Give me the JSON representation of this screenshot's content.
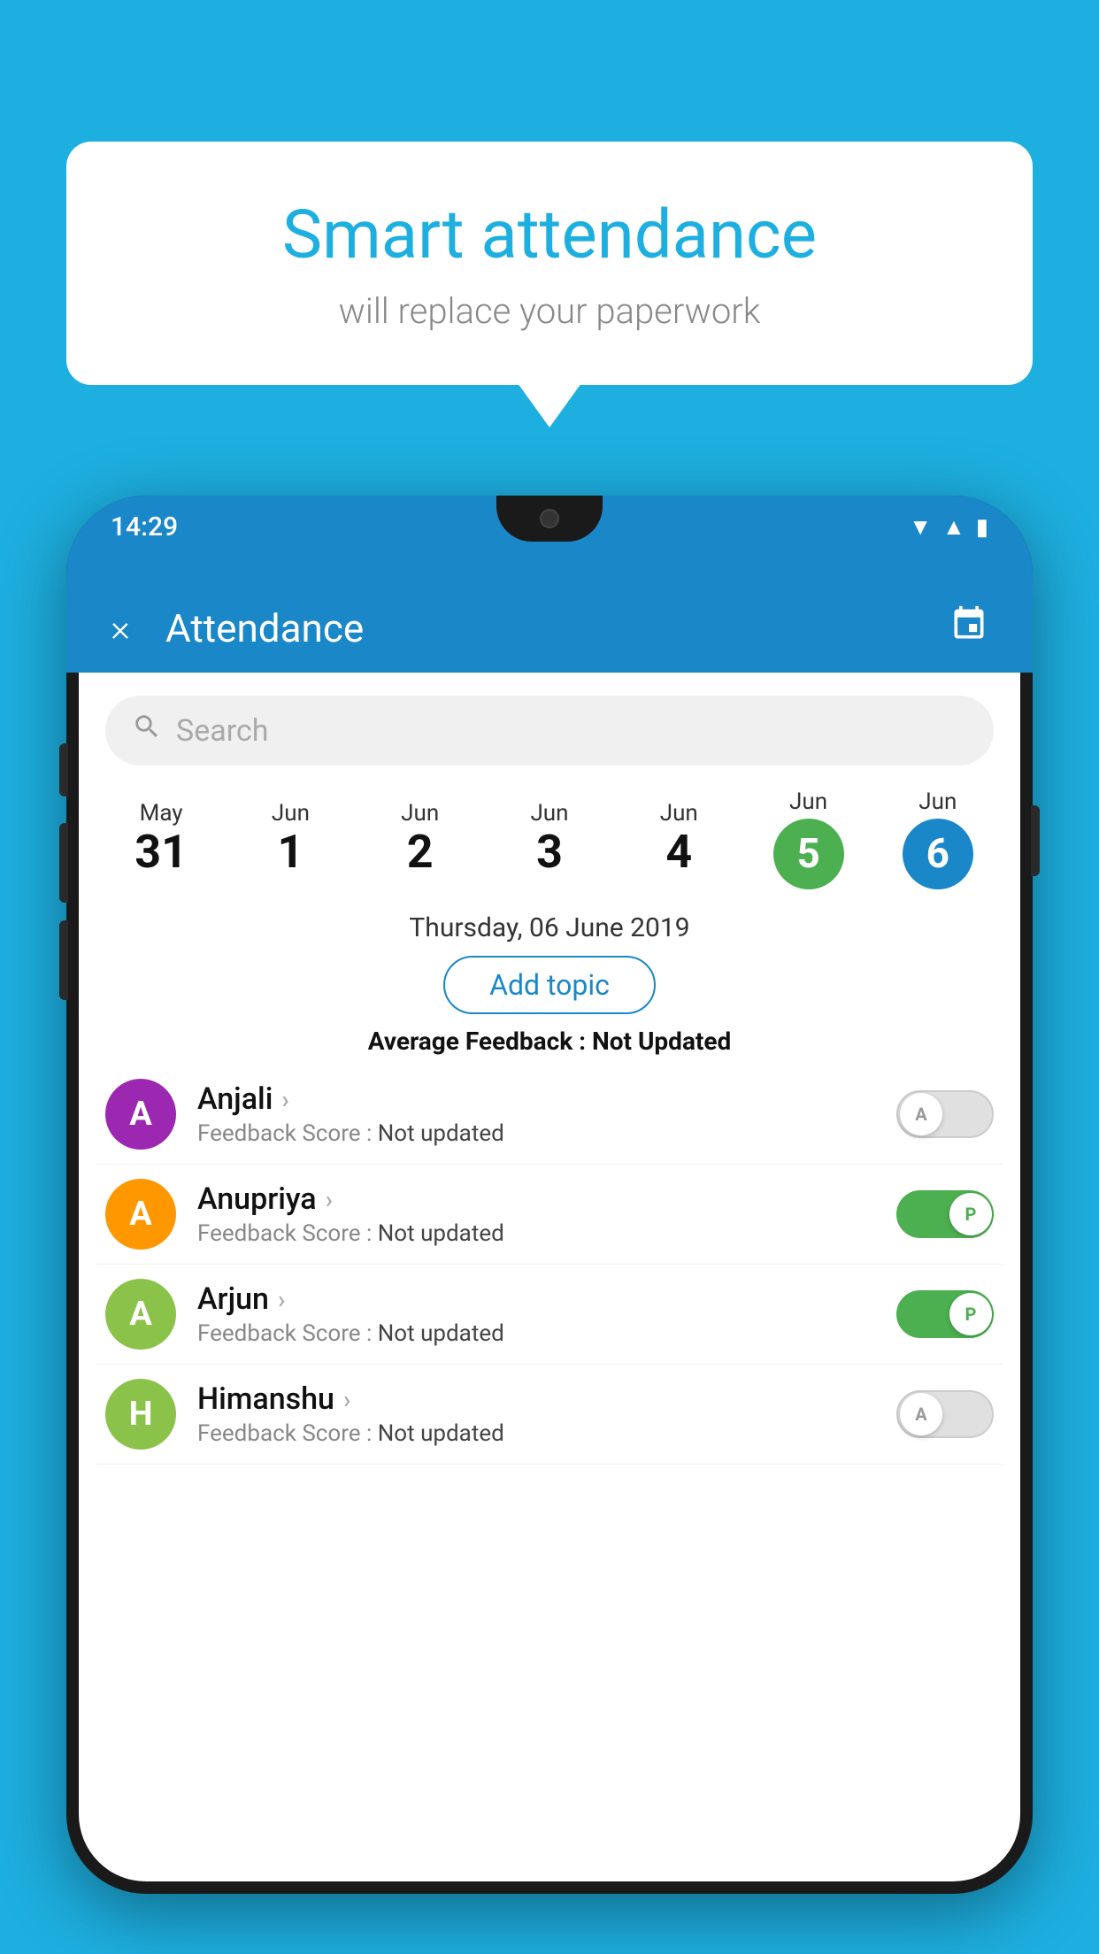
{
  "background_color": "#1DAFE0",
  "speech_bubble": {
    "title": "Smart attendance",
    "subtitle": "will replace your paperwork"
  },
  "status_bar": {
    "time": "14:29",
    "icons": [
      "wifi",
      "signal",
      "battery"
    ]
  },
  "app_header": {
    "title": "Attendance",
    "close_label": "×",
    "calendar_label": "📅"
  },
  "search": {
    "placeholder": "Search"
  },
  "calendar": {
    "dates": [
      {
        "month": "May",
        "day": "31",
        "highlight": null
      },
      {
        "month": "Jun",
        "day": "1",
        "highlight": null
      },
      {
        "month": "Jun",
        "day": "2",
        "highlight": null
      },
      {
        "month": "Jun",
        "day": "3",
        "highlight": null
      },
      {
        "month": "Jun",
        "day": "4",
        "highlight": null
      },
      {
        "month": "Jun",
        "day": "5",
        "highlight": "green"
      },
      {
        "month": "Jun",
        "day": "6",
        "highlight": "blue"
      }
    ]
  },
  "selected_date": "Thursday, 06 June 2019",
  "add_topic_label": "Add topic",
  "avg_feedback_label": "Average Feedback :",
  "avg_feedback_value": "Not Updated",
  "students": [
    {
      "name": "Anjali",
      "avatar_letter": "A",
      "avatar_color": "#9C27B0",
      "feedback_label": "Feedback Score :",
      "feedback_value": "Not updated",
      "toggle_state": "off",
      "toggle_letter": "A"
    },
    {
      "name": "Anupriya",
      "avatar_letter": "A",
      "avatar_color": "#FF9800",
      "feedback_label": "Feedback Score :",
      "feedback_value": "Not updated",
      "toggle_state": "on",
      "toggle_letter": "P"
    },
    {
      "name": "Arjun",
      "avatar_letter": "A",
      "avatar_color": "#8BC34A",
      "feedback_label": "Feedback Score :",
      "feedback_value": "Not updated",
      "toggle_state": "on",
      "toggle_letter": "P"
    },
    {
      "name": "Himanshu",
      "avatar_letter": "H",
      "avatar_color": "#8BC34A",
      "feedback_label": "Feedback Score :",
      "feedback_value": "Not updated",
      "toggle_state": "off",
      "toggle_letter": "A"
    }
  ]
}
